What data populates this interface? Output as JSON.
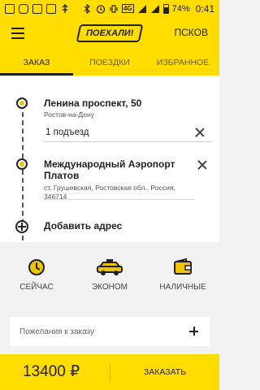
{
  "status_bar": {
    "network": "4G",
    "battery": "74%",
    "time": "0:41"
  },
  "app_bar": {
    "logo": "ПОЕХАЛИ!",
    "city": "ПСКОВ"
  },
  "tabs": [
    {
      "label": "ЗАКАЗ",
      "active": true
    },
    {
      "label": "ПОЕЗДКИ",
      "active": false
    },
    {
      "label": "ИЗБРАННОЕ",
      "active": false
    }
  ],
  "route": {
    "from": {
      "title": "Ленина проспект, 50",
      "subtitle": "Ростов-на-Дону",
      "entrance_value": "1 подъезд"
    },
    "to": {
      "title_line1": "Международный Аэропорт",
      "title_line2": "Платов",
      "subtitle_line1": "ст. Грушевская, Ростовская обл., Россия,",
      "subtitle_line2": "346714"
    },
    "add_label": "Добавить адрес"
  },
  "options": [
    {
      "icon": "clock-icon",
      "label": "СЕЙЧАС"
    },
    {
      "icon": "taxi-car-icon",
      "label": "ЭКОНОМ"
    },
    {
      "icon": "wallet-icon",
      "label": "НАЛИЧНЫЕ"
    }
  ],
  "wishes": {
    "placeholder": "Пожелания к заказу"
  },
  "bottom": {
    "price": "13400 ₽",
    "order_label": "ЗАКАЗАТЬ"
  },
  "colors": {
    "brand_yellow": "#ffdd00",
    "accent_dark": "#222222"
  }
}
